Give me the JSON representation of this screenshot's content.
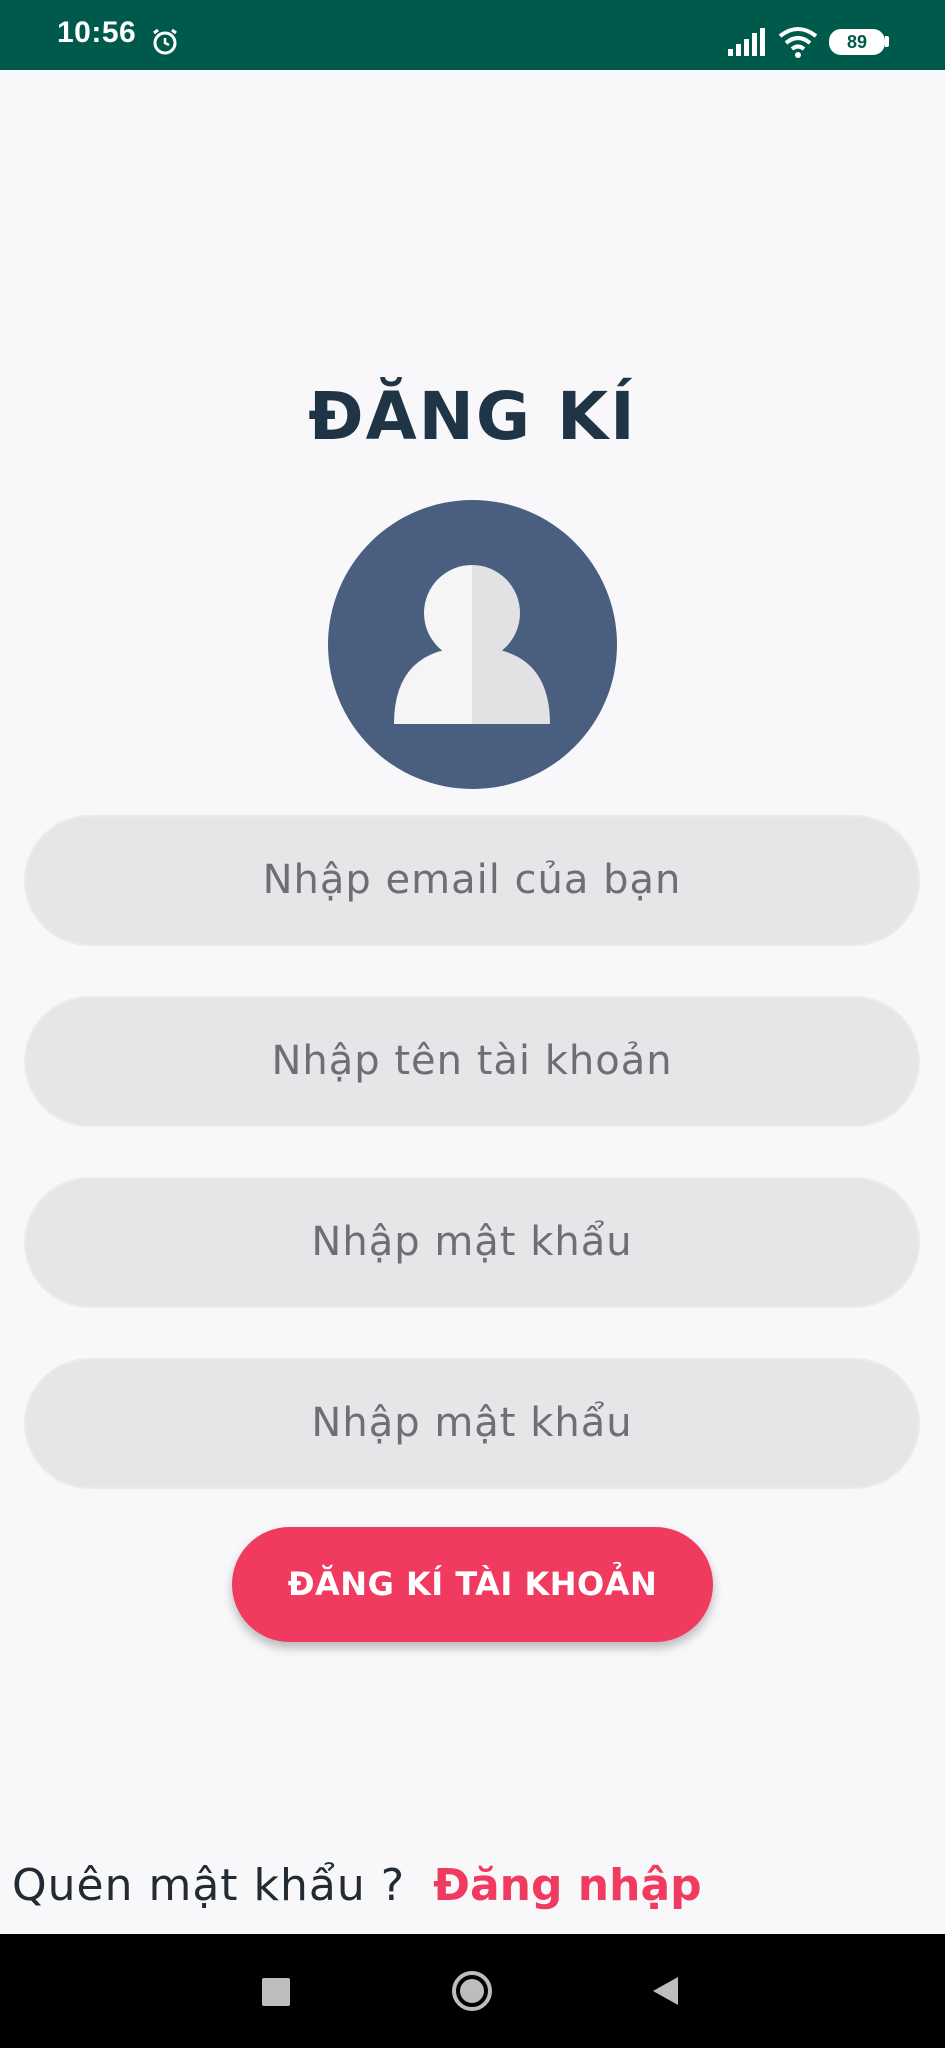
{
  "status_bar": {
    "time": "10:56",
    "battery": "89",
    "icons": [
      "alarm-icon",
      "signal-icon",
      "wifi-icon",
      "battery-icon"
    ]
  },
  "title": "ĐĂNG KÍ",
  "avatar": {
    "icon": "user-avatar-icon",
    "background_color": "#4a5e80"
  },
  "form": {
    "email_placeholder": "Nhập email của bạn",
    "username_placeholder": "Nhập tên tài khoản",
    "password_placeholder": "Nhập mật khẩu",
    "confirm_password_placeholder": "Nhập mật khẩu",
    "submit_label": "ĐĂNG KÍ TÀI KHOẢN"
  },
  "footer": {
    "forgot_password": "Quên mật khẩu ?",
    "login": "Đăng nhập"
  },
  "navigation": {
    "icons": [
      "recent-apps-icon",
      "home-icon",
      "back-icon"
    ]
  },
  "colors": {
    "status_bar": "#005a4c",
    "accent": "#f03a60",
    "title": "#1f3444",
    "input_background": "#e6e6e9",
    "page_background": "#f8f8fa"
  }
}
